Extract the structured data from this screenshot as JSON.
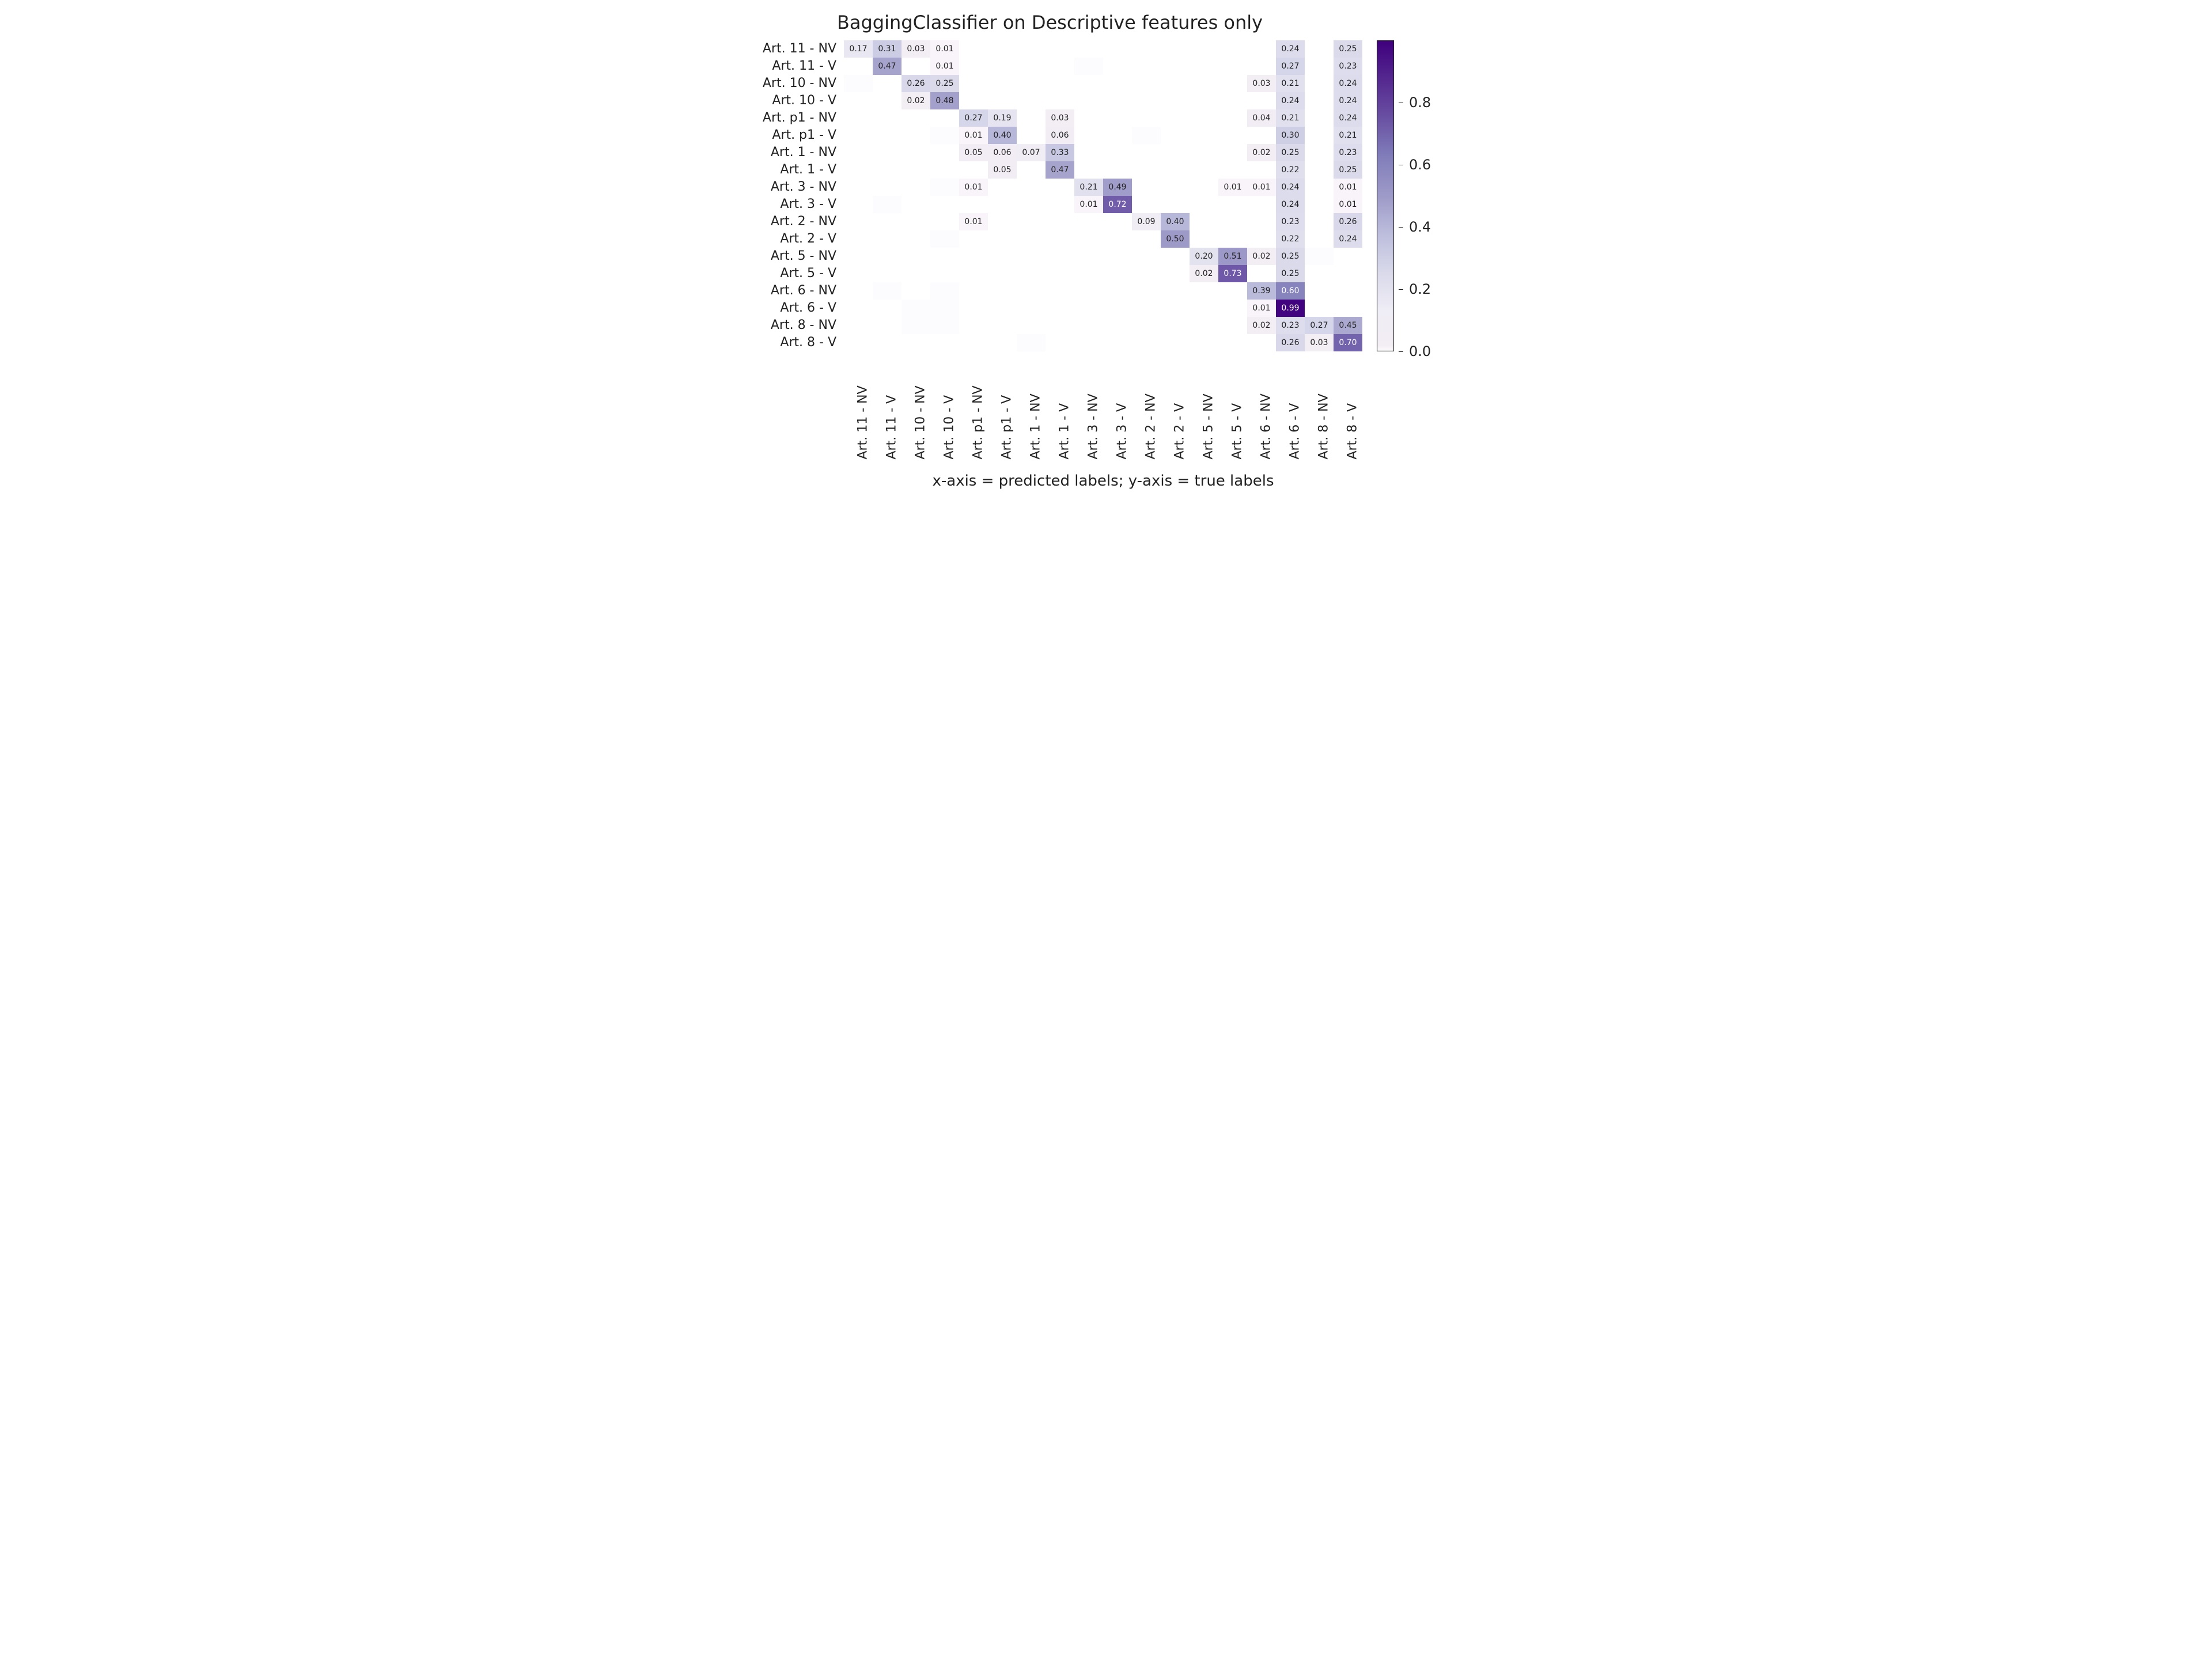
{
  "chart_data": {
    "type": "heatmap",
    "title": "BaggingClassifier on Descriptive features only",
    "xlabel": "x-axis = predicted labels; y-axis = true labels",
    "ylabel": "",
    "categories": [
      "Art. 11 - NV",
      "Art. 11 - V",
      "Art. 10 - NV",
      "Art. 10 - V",
      "Art. p1 - NV",
      "Art. p1 - V",
      "Art. 1 - NV",
      "Art. 1 - V",
      "Art. 3 - NV",
      "Art. 3 - V",
      "Art. 2 - NV",
      "Art. 2 - V",
      "Art. 5 - NV",
      "Art. 5 - V",
      "Art. 6 - NV",
      "Art. 6 - V",
      "Art. 8 - NV",
      "Art. 8 - V"
    ],
    "matrix": [
      [
        0.17,
        0.31,
        0.03,
        0.01,
        null,
        null,
        null,
        null,
        null,
        null,
        null,
        null,
        null,
        null,
        null,
        0.24,
        null,
        0.25
      ],
      [
        null,
        0.47,
        null,
        0.01,
        null,
        null,
        null,
        null,
        0.0,
        null,
        null,
        null,
        null,
        null,
        null,
        0.27,
        null,
        0.23
      ],
      [
        0.0,
        null,
        0.26,
        0.25,
        null,
        null,
        null,
        null,
        null,
        null,
        null,
        null,
        null,
        null,
        0.03,
        0.21,
        null,
        0.24
      ],
      [
        null,
        null,
        0.02,
        0.48,
        null,
        null,
        null,
        null,
        null,
        null,
        null,
        null,
        null,
        null,
        null,
        0.24,
        null,
        0.24
      ],
      [
        null,
        null,
        null,
        null,
        0.27,
        0.19,
        null,
        0.03,
        null,
        null,
        null,
        null,
        null,
        null,
        0.04,
        0.21,
        null,
        0.24
      ],
      [
        null,
        null,
        null,
        0.0,
        0.01,
        0.4,
        null,
        0.06,
        null,
        null,
        0.0,
        null,
        null,
        null,
        null,
        0.3,
        null,
        0.21
      ],
      [
        null,
        null,
        null,
        null,
        0.05,
        0.06,
        0.07,
        0.33,
        null,
        null,
        null,
        null,
        null,
        null,
        0.02,
        0.25,
        null,
        0.23
      ],
      [
        null,
        null,
        null,
        null,
        null,
        0.05,
        null,
        0.47,
        null,
        null,
        null,
        null,
        null,
        null,
        null,
        0.22,
        null,
        0.25
      ],
      [
        null,
        null,
        null,
        0.0,
        0.01,
        null,
        null,
        null,
        0.21,
        0.49,
        null,
        null,
        null,
        0.01,
        0.01,
        0.24,
        null,
        0.01
      ],
      [
        null,
        0.0,
        null,
        null,
        null,
        null,
        null,
        null,
        0.01,
        0.72,
        null,
        null,
        null,
        null,
        null,
        0.24,
        null,
        0.01
      ],
      [
        null,
        null,
        null,
        null,
        0.01,
        null,
        null,
        null,
        null,
        null,
        0.09,
        0.4,
        null,
        null,
        null,
        0.23,
        null,
        0.26
      ],
      [
        null,
        null,
        null,
        0.0,
        null,
        null,
        null,
        null,
        null,
        null,
        null,
        0.5,
        null,
        null,
        null,
        0.22,
        null,
        0.24
      ],
      [
        null,
        null,
        null,
        null,
        null,
        null,
        null,
        null,
        null,
        null,
        null,
        null,
        0.2,
        0.51,
        0.02,
        0.25,
        0.0,
        null
      ],
      [
        null,
        null,
        null,
        null,
        null,
        null,
        null,
        null,
        null,
        null,
        null,
        null,
        0.02,
        0.73,
        null,
        0.25,
        null,
        null
      ],
      [
        null,
        0.0,
        null,
        0.0,
        null,
        null,
        null,
        null,
        null,
        null,
        null,
        null,
        null,
        null,
        0.39,
        0.6,
        null,
        null
      ],
      [
        null,
        null,
        0.0,
        0.0,
        null,
        null,
        null,
        null,
        null,
        null,
        null,
        null,
        null,
        null,
        0.01,
        0.99,
        null,
        null
      ],
      [
        null,
        null,
        0.0,
        0.0,
        null,
        null,
        null,
        null,
        null,
        null,
        null,
        null,
        null,
        null,
        0.02,
        0.23,
        0.27,
        0.45
      ],
      [
        null,
        null,
        null,
        null,
        null,
        null,
        0.0,
        null,
        null,
        null,
        null,
        null,
        null,
        null,
        null,
        0.26,
        0.03,
        0.7
      ]
    ],
    "value_range": [
      0.0,
      1.0
    ],
    "colorbar_ticks": [
      0.0,
      0.2,
      0.4,
      0.6,
      0.8
    ]
  }
}
